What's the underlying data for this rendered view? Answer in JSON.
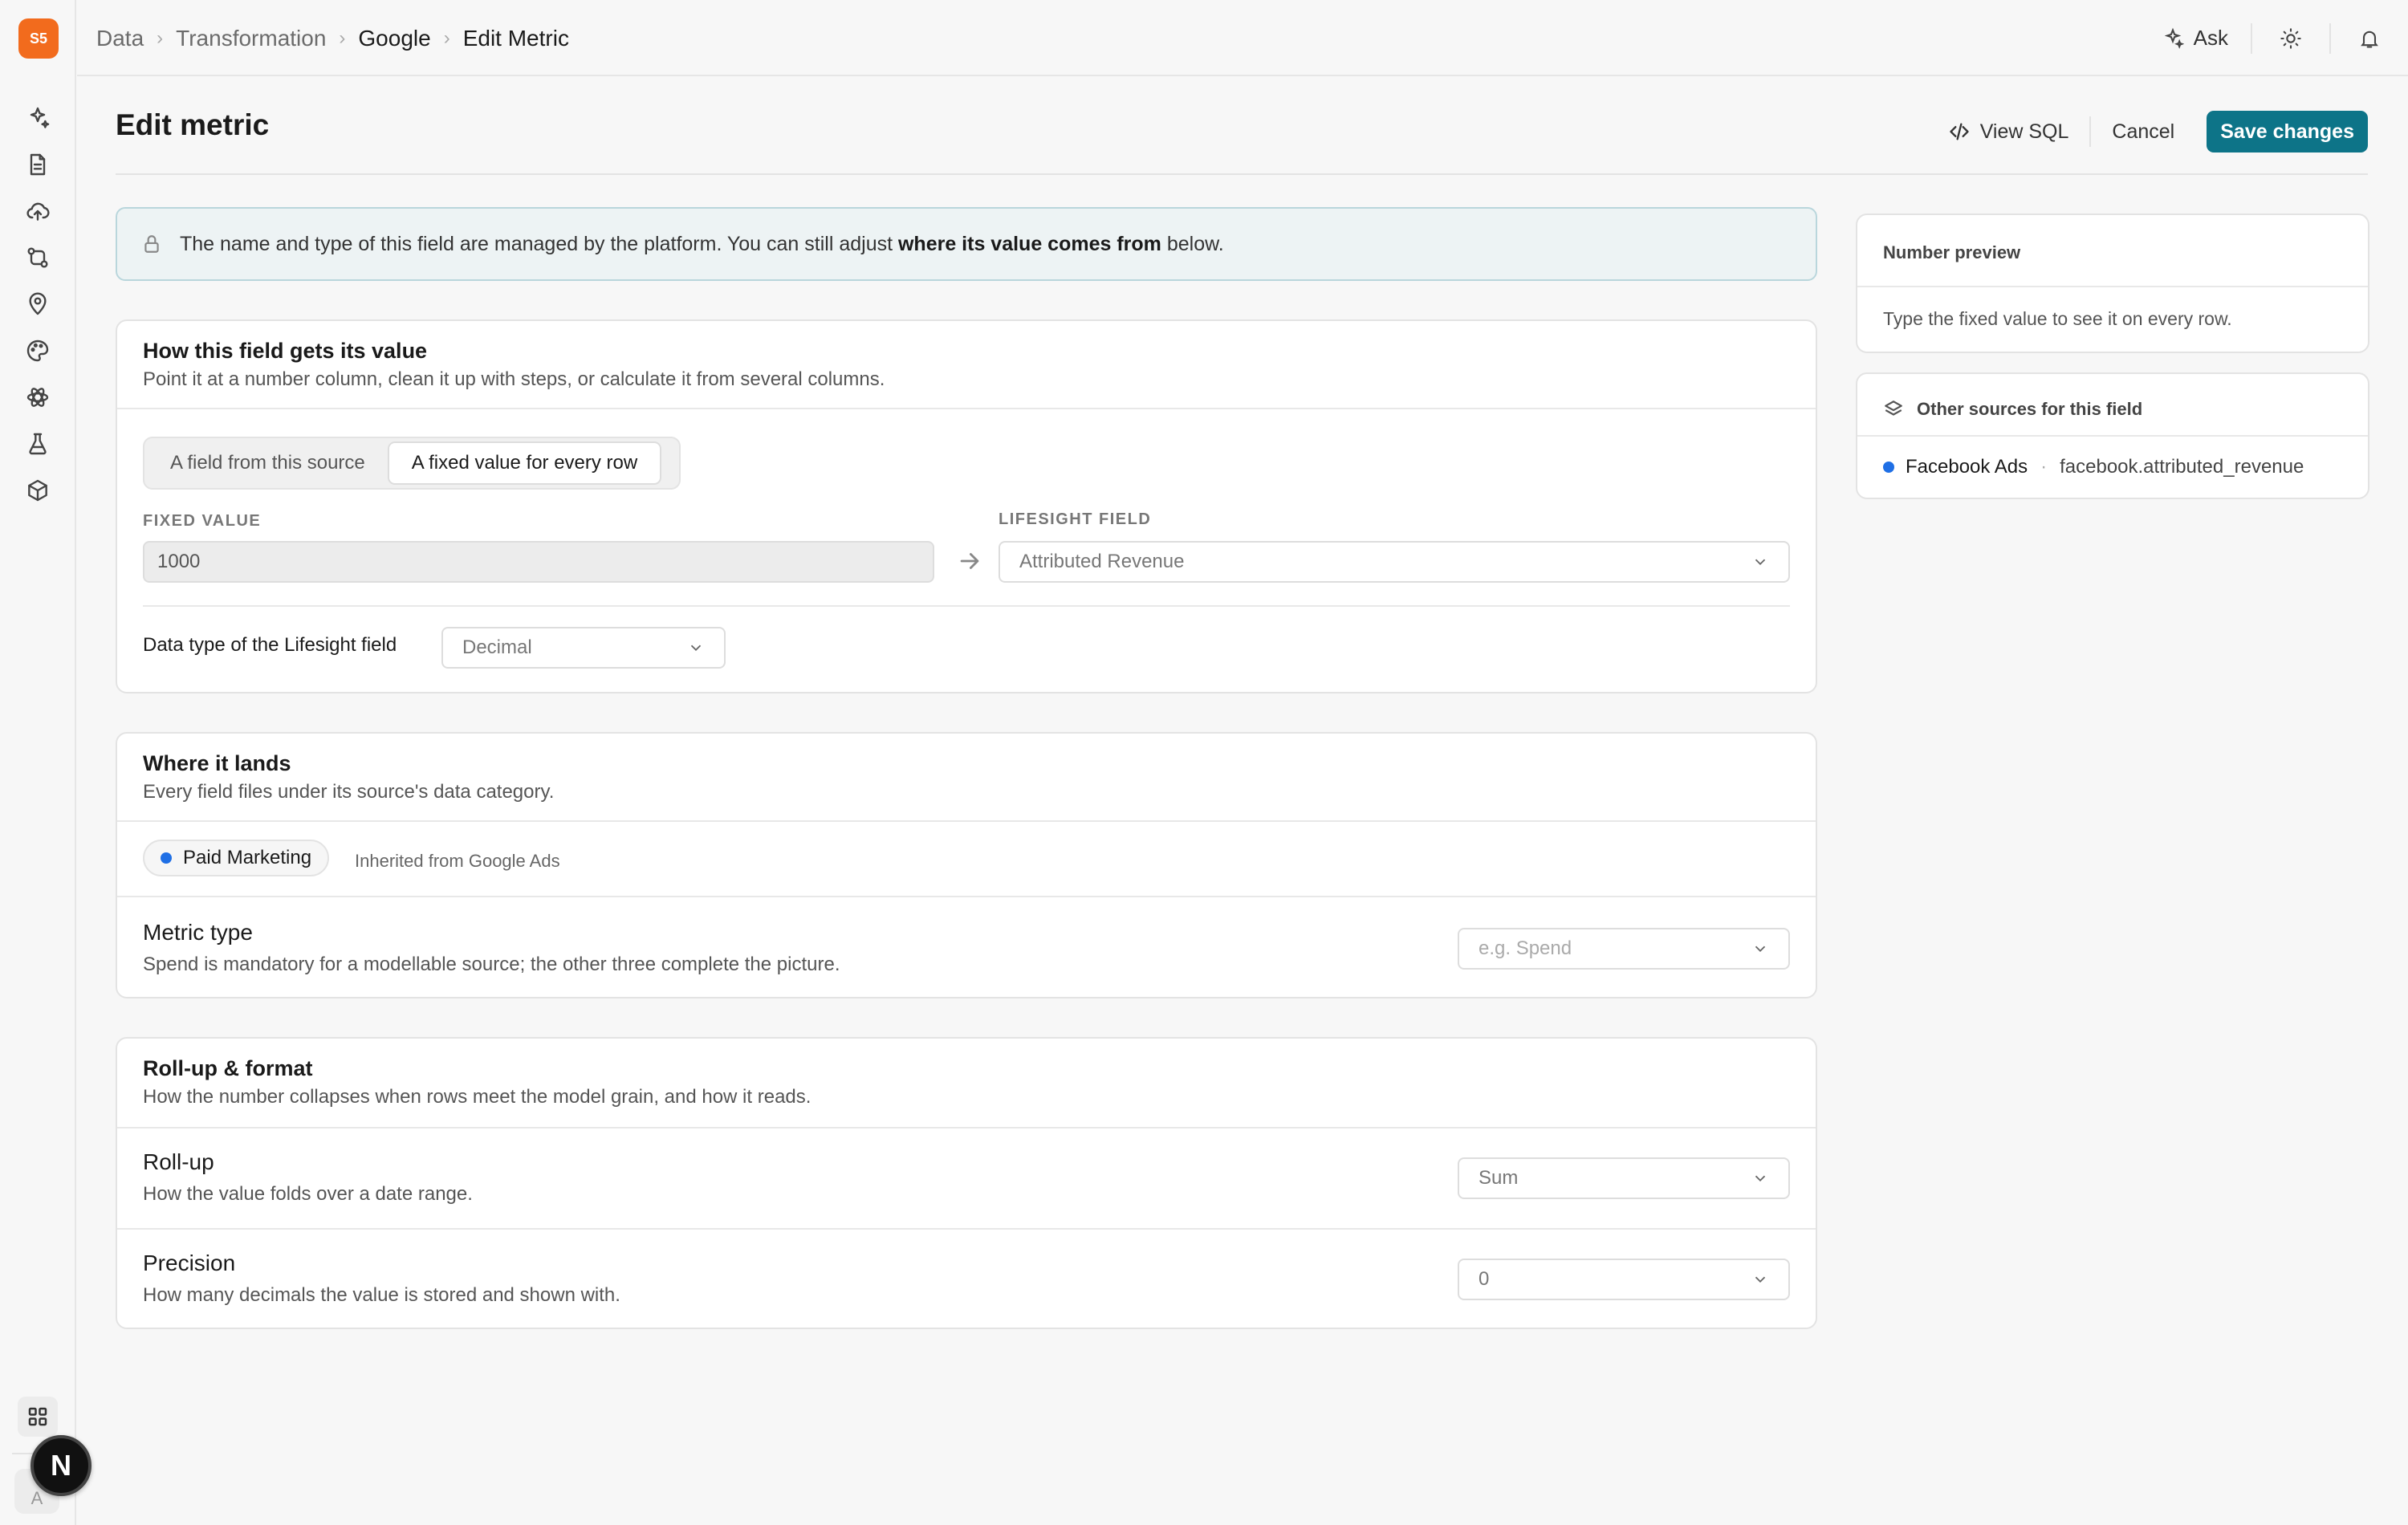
{
  "sidebar": {
    "logo_text": "S5",
    "icons": [
      "sparkle-icon",
      "document-icon",
      "upload-cloud-icon",
      "git-compare-icon",
      "map-pin-icon",
      "palette-icon",
      "atom-icon",
      "flask-icon",
      "cube-icon"
    ],
    "avatar_letter": "A",
    "badge_letter": "N"
  },
  "topbar": {
    "breadcrumbs": [
      "Data",
      "Transformation",
      "Google",
      "Edit Metric"
    ],
    "ask_label": "Ask"
  },
  "header": {
    "title": "Edit metric",
    "view_sql_label": "View SQL",
    "cancel_label": "Cancel",
    "save_label": "Save changes"
  },
  "banner": {
    "text_before": "The name and type of this field are managed by the platform. You can still adjust ",
    "text_bold": "where its value comes from",
    "text_after": " below."
  },
  "value_card": {
    "title": "How this field gets its value",
    "subtitle": "Point it at a number column, clean it up with steps, or calculate it from several columns.",
    "tabs": [
      "A field from this source",
      "A fixed value for every row"
    ],
    "active_tab": 1,
    "fixed_value_label": "FIXED VALUE",
    "fixed_value": "1000",
    "lifesight_field_label": "LIFESIGHT FIELD",
    "lifesight_field_value": "Attributed Revenue",
    "data_type_label": "Data type of the Lifesight field",
    "data_type_value": "Decimal"
  },
  "lands_card": {
    "title": "Where it lands",
    "subtitle": "Every field files under its source's data category.",
    "category": "Paid Marketing",
    "category_color": "#1f6fe5",
    "inherited_text": "Inherited from Google Ads",
    "metric_type_title": "Metric type",
    "metric_type_sub": "Spend is mandatory for a modellable source; the other three complete the picture.",
    "metric_type_placeholder": "e.g. Spend"
  },
  "rollup_card": {
    "title": "Roll-up & format",
    "subtitle": "How the number collapses when rows meet the model grain, and how it reads.",
    "rollup_title": "Roll-up",
    "rollup_sub": "How the value folds over a date range.",
    "rollup_value": "Sum",
    "precision_title": "Precision",
    "precision_sub": "How many decimals the value is stored and shown with.",
    "precision_value": "0"
  },
  "preview": {
    "title": "Number preview",
    "body": "Type the fixed value to see it on every row."
  },
  "other_sources": {
    "title": "Other sources for this field",
    "items": [
      {
        "source": "Facebook Ads",
        "field": "facebook.attributed_revenue",
        "color": "#1f6fe5"
      }
    ]
  },
  "colors": {
    "accent": "#0d7488",
    "brand": "#f26b1d",
    "banner_bg": "#edf3f4"
  }
}
